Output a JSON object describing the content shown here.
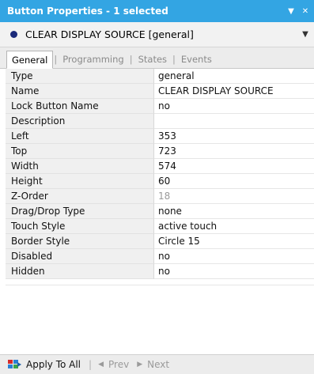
{
  "window": {
    "title": "Button Properties - 1 selected",
    "menu_icon": "dropdown-arrow-icon",
    "close_icon": "close-icon",
    "accent_color": "#33a5e3"
  },
  "selector": {
    "text": "CLEAR DISPLAY SOURCE  [general]",
    "dot_icon": "bullet-icon",
    "chevron_icon": "chevron-down-icon"
  },
  "tabs": [
    {
      "label": "General",
      "active": true
    },
    {
      "label": "Programming",
      "active": false
    },
    {
      "label": "States",
      "active": false
    },
    {
      "label": "Events",
      "active": false
    }
  ],
  "properties": [
    {
      "label": "Type",
      "value": "general"
    },
    {
      "label": "Name",
      "value": "CLEAR DISPLAY SOURCE"
    },
    {
      "label": "Lock Button Name",
      "value": "no"
    },
    {
      "label": "Description",
      "value": ""
    },
    {
      "label": "Left",
      "value": "353"
    },
    {
      "label": "Top",
      "value": "723"
    },
    {
      "label": "Width",
      "value": "574"
    },
    {
      "label": "Height",
      "value": "60"
    },
    {
      "label": "Z-Order",
      "value": "18",
      "disabled": true
    },
    {
      "label": "Drag/Drop Type",
      "value": "none"
    },
    {
      "label": "Touch Style",
      "value": "active touch"
    },
    {
      "label": "Border Style",
      "value": "Circle 15"
    },
    {
      "label": "Disabled",
      "value": "no"
    },
    {
      "label": "Hidden",
      "value": "no"
    }
  ],
  "footer": {
    "apply_label": "Apply To All",
    "apply_icon": "apply-to-all-icon",
    "prev_label": "Prev",
    "next_label": "Next",
    "prev_icon": "prev-arrow-icon",
    "next_icon": "next-arrow-icon"
  }
}
